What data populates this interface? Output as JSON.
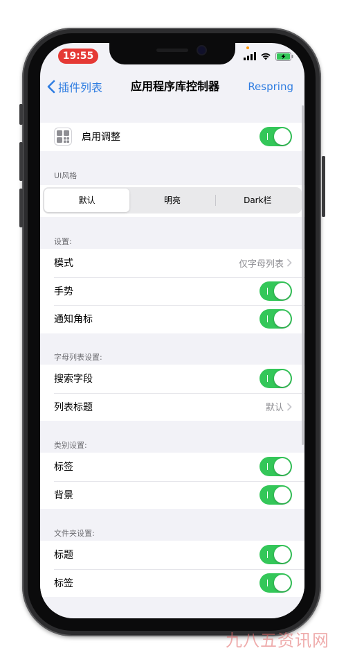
{
  "status_bar": {
    "time": "19:55",
    "icons": [
      "cellular-signal-icon",
      "wifi-icon",
      "battery-charging-icon"
    ],
    "time_pill_color": "#e53935"
  },
  "nav": {
    "back_label": "插件列表",
    "title": "应用程序库控制器",
    "action_label": "Respring"
  },
  "enable": {
    "label": "启用调整",
    "enabled": true
  },
  "ui_style": {
    "header": "UI风格",
    "options": [
      "默认",
      "明亮",
      "Dark栏"
    ],
    "selected": "默认"
  },
  "settings": {
    "header": "设置:",
    "rows": [
      {
        "label": "模式",
        "value": "仅字母列表"
      },
      {
        "label": "手势",
        "enabled": true
      },
      {
        "label": "通知角标",
        "enabled": true
      }
    ]
  },
  "alphabet_list": {
    "header": "字母列表设置:",
    "rows": [
      {
        "label": "搜索字段",
        "enabled": true
      },
      {
        "label": "列表标题",
        "value": "默认"
      }
    ]
  },
  "category": {
    "header": "类别设置:",
    "rows": [
      {
        "label": "标签",
        "enabled": true
      },
      {
        "label": "背景",
        "enabled": true
      }
    ]
  },
  "folder": {
    "header": "文件夹设置:",
    "rows": [
      {
        "label": "标题",
        "enabled": true
      },
      {
        "label": "标签",
        "enabled": true
      }
    ]
  },
  "colors": {
    "accent": "#2f7de1",
    "toggle_on": "#34c759",
    "background": "#f2f2f7"
  },
  "watermark": "九八五资讯网"
}
